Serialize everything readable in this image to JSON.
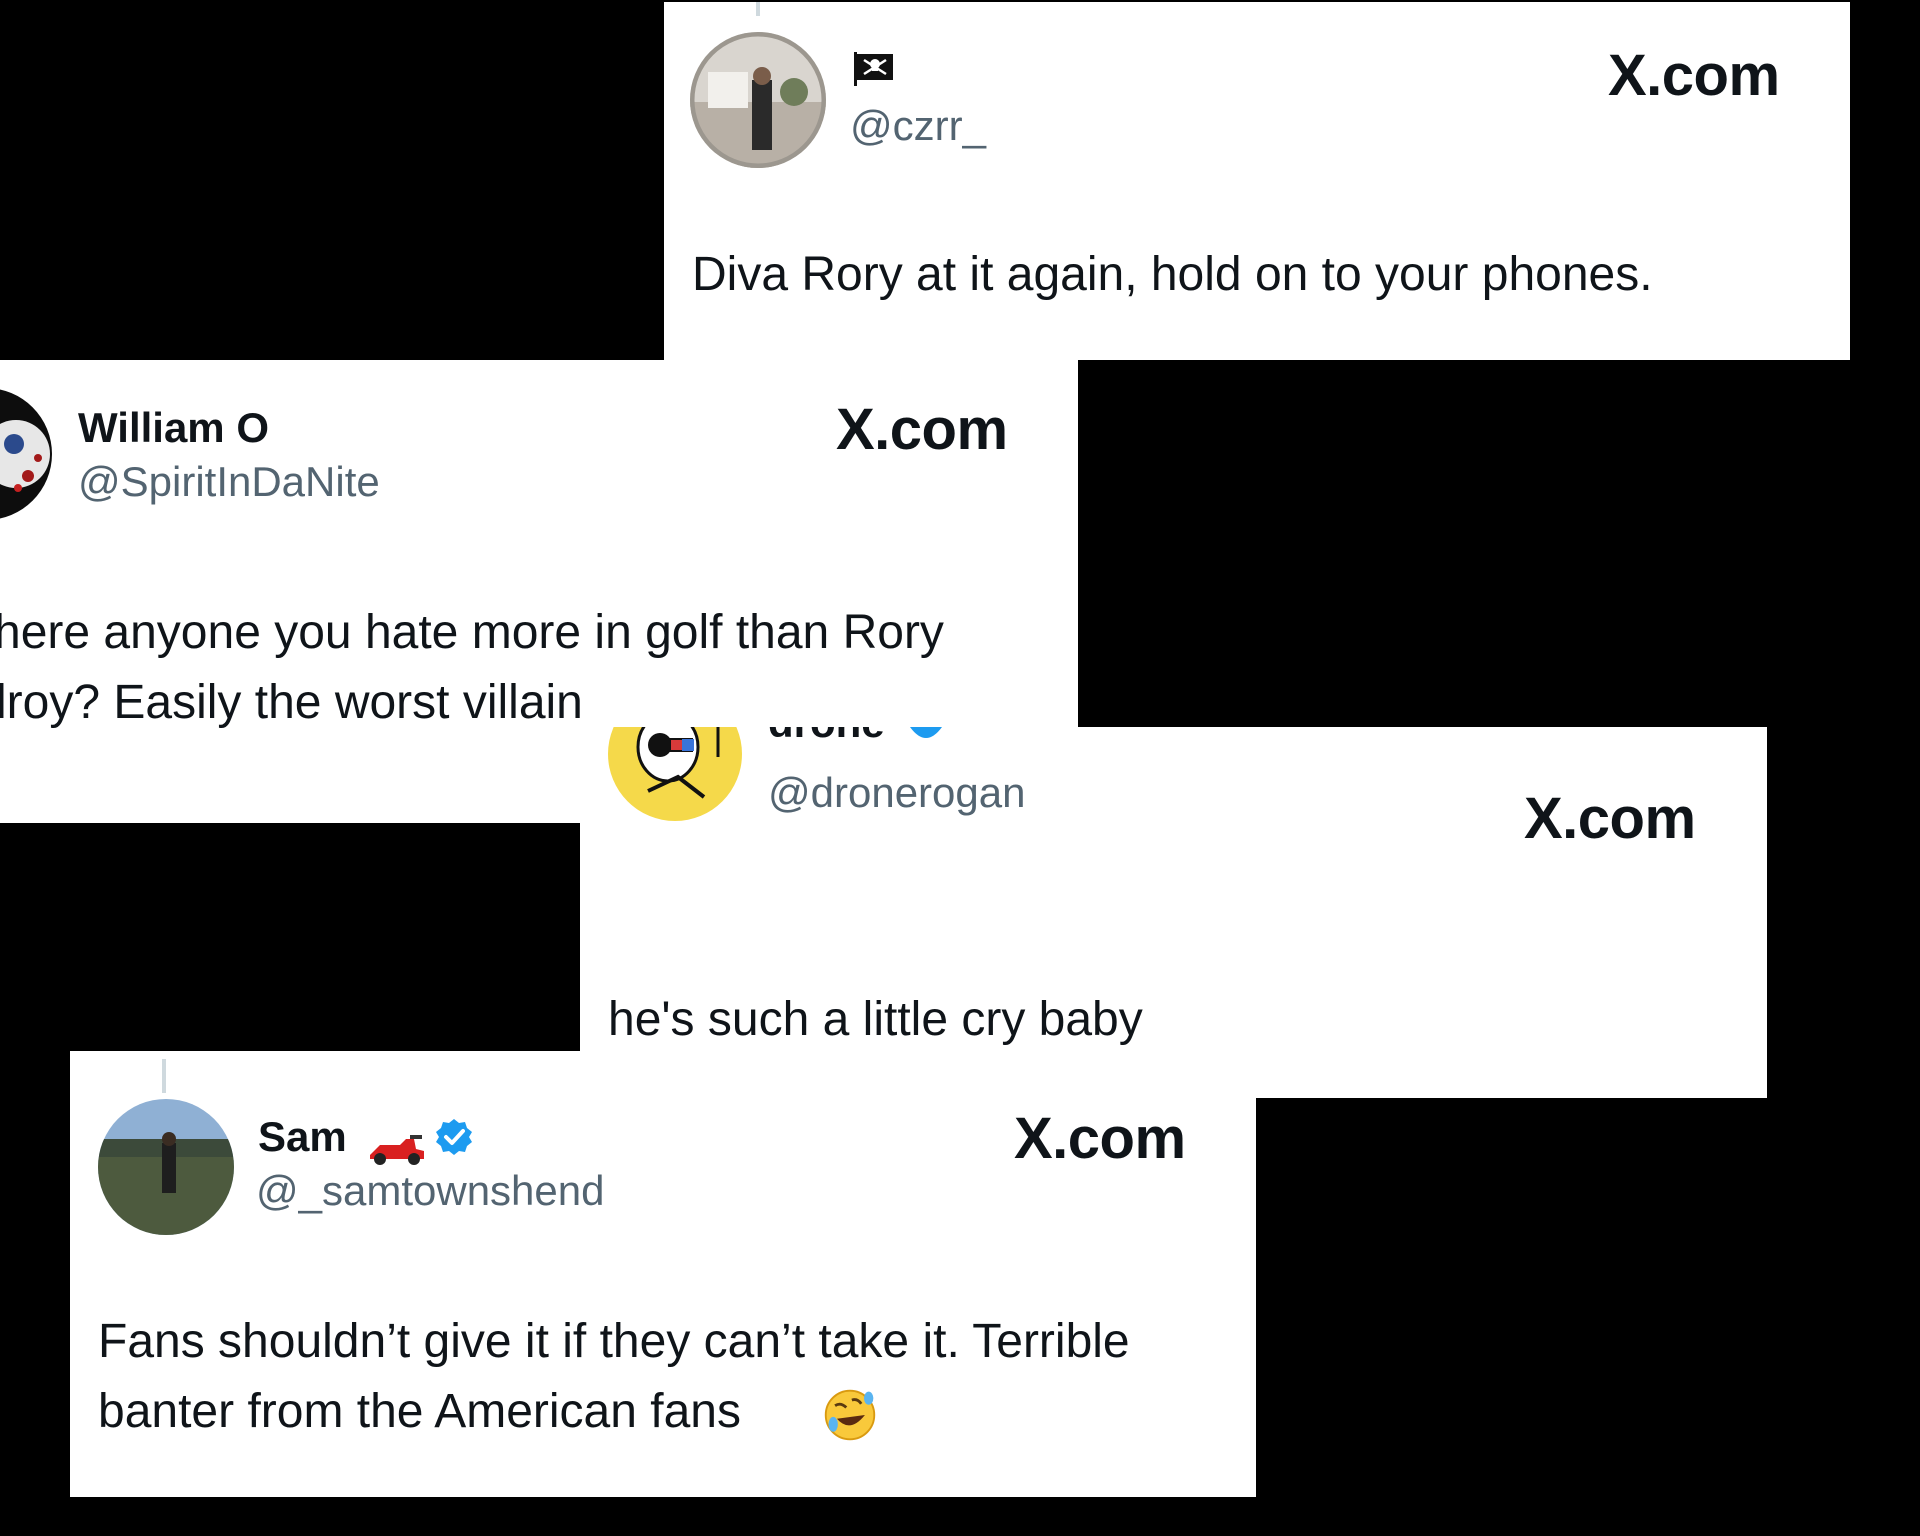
{
  "cards": [
    {
      "display_name": "",
      "flag_icon": "pirate-flag-icon",
      "handle": "@czrr_",
      "brand": "X.com",
      "text_lines": [
        "Diva Rory at it again, hold on to your phones."
      ]
    },
    {
      "display_name": "William O",
      "handle": "@SpiritInDaNite",
      "brand": "X.com",
      "text_lines": [
        "here anyone you hate more in golf than Rory",
        "lroy? Easily the worst villain"
      ]
    },
    {
      "display_name": "drone",
      "verified": true,
      "handle": "@dronerogan",
      "brand": "X.com",
      "text_lines": [
        "he's such a little cry baby"
      ]
    },
    {
      "display_name": "Sam",
      "name_emoji": "race-car-icon",
      "verified": true,
      "handle": "@_samtownshend",
      "brand": "X.com",
      "text_lines": [
        "Fans shouldn’t give it if they can’t take it. Terrible",
        "banter from the American fans"
      ],
      "trailing_emoji": "rolling-on-floor-laughing-icon"
    }
  ],
  "colors": {
    "background": "#000000",
    "card": "#ffffff",
    "text": "#0f1419",
    "handle": "#536471",
    "verified": "#1d9bf0"
  }
}
